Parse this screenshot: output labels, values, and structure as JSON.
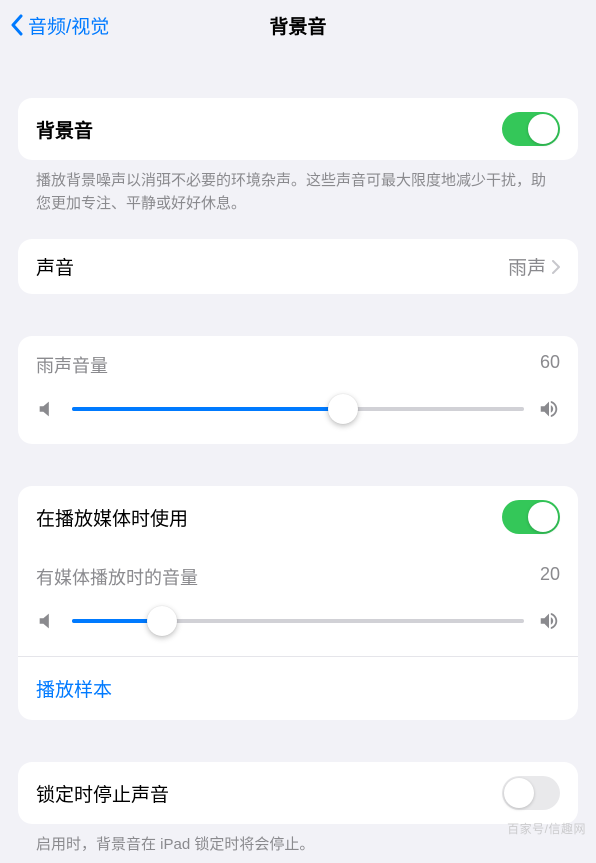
{
  "nav": {
    "back_label": "音频/视觉",
    "title": "背景音"
  },
  "main_toggle": {
    "label": "背景音",
    "on": true,
    "description": "播放背景噪声以消弭不必要的环境杂声。这些声音可最大限度地减少干扰，助您更加专注、平静或好好休息。"
  },
  "sound_row": {
    "label": "声音",
    "value": "雨声"
  },
  "volume1": {
    "label": "雨声音量",
    "value": 60
  },
  "media_use": {
    "toggle_label": "在播放媒体时使用",
    "toggle_on": true,
    "volume_label": "有媒体播放时的音量",
    "volume_value": 20,
    "sample_link": "播放样本"
  },
  "lock_stop": {
    "label": "锁定时停止声音",
    "on": false,
    "description": "启用时，背景音在 iPad 锁定时将会停止。"
  },
  "watermark": "百家号/信趣网"
}
